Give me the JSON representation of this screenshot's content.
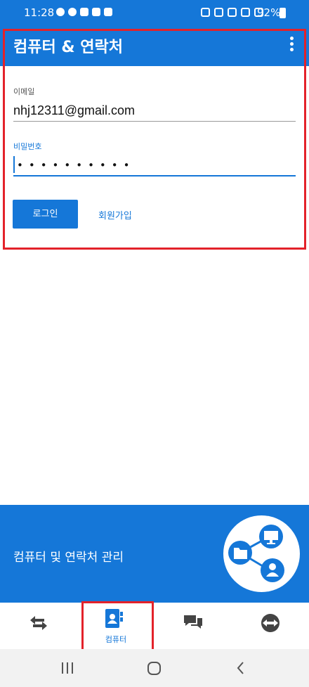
{
  "status_bar": {
    "time": "11:28",
    "battery": "92%"
  },
  "header": {
    "title": "컴퓨터 & 연락처",
    "menu_icon": "more-vertical-icon"
  },
  "login_form": {
    "email_label": "이메일",
    "email_value": "nhj12311@gmail.com",
    "password_label": "비밀번호",
    "password_masked": "••••••••••",
    "login_button": "로그인",
    "signup_link": "회원가입"
  },
  "promo": {
    "text": "컴퓨터 및 연락처 관리",
    "icon": "share-network-icon"
  },
  "bottom_nav": {
    "tabs": [
      {
        "icon": "arrows-transfer-icon",
        "label": ""
      },
      {
        "icon": "contacts-book-icon",
        "label": "컴퓨터",
        "active": true
      },
      {
        "icon": "chat-icon",
        "label": ""
      },
      {
        "icon": "teamviewer-icon",
        "label": ""
      }
    ]
  },
  "system_nav": {
    "buttons": [
      "recent-apps-icon",
      "home-icon",
      "back-icon"
    ]
  },
  "colors": {
    "brand_blue": "#1577d8",
    "highlight_red": "#e3222a"
  }
}
